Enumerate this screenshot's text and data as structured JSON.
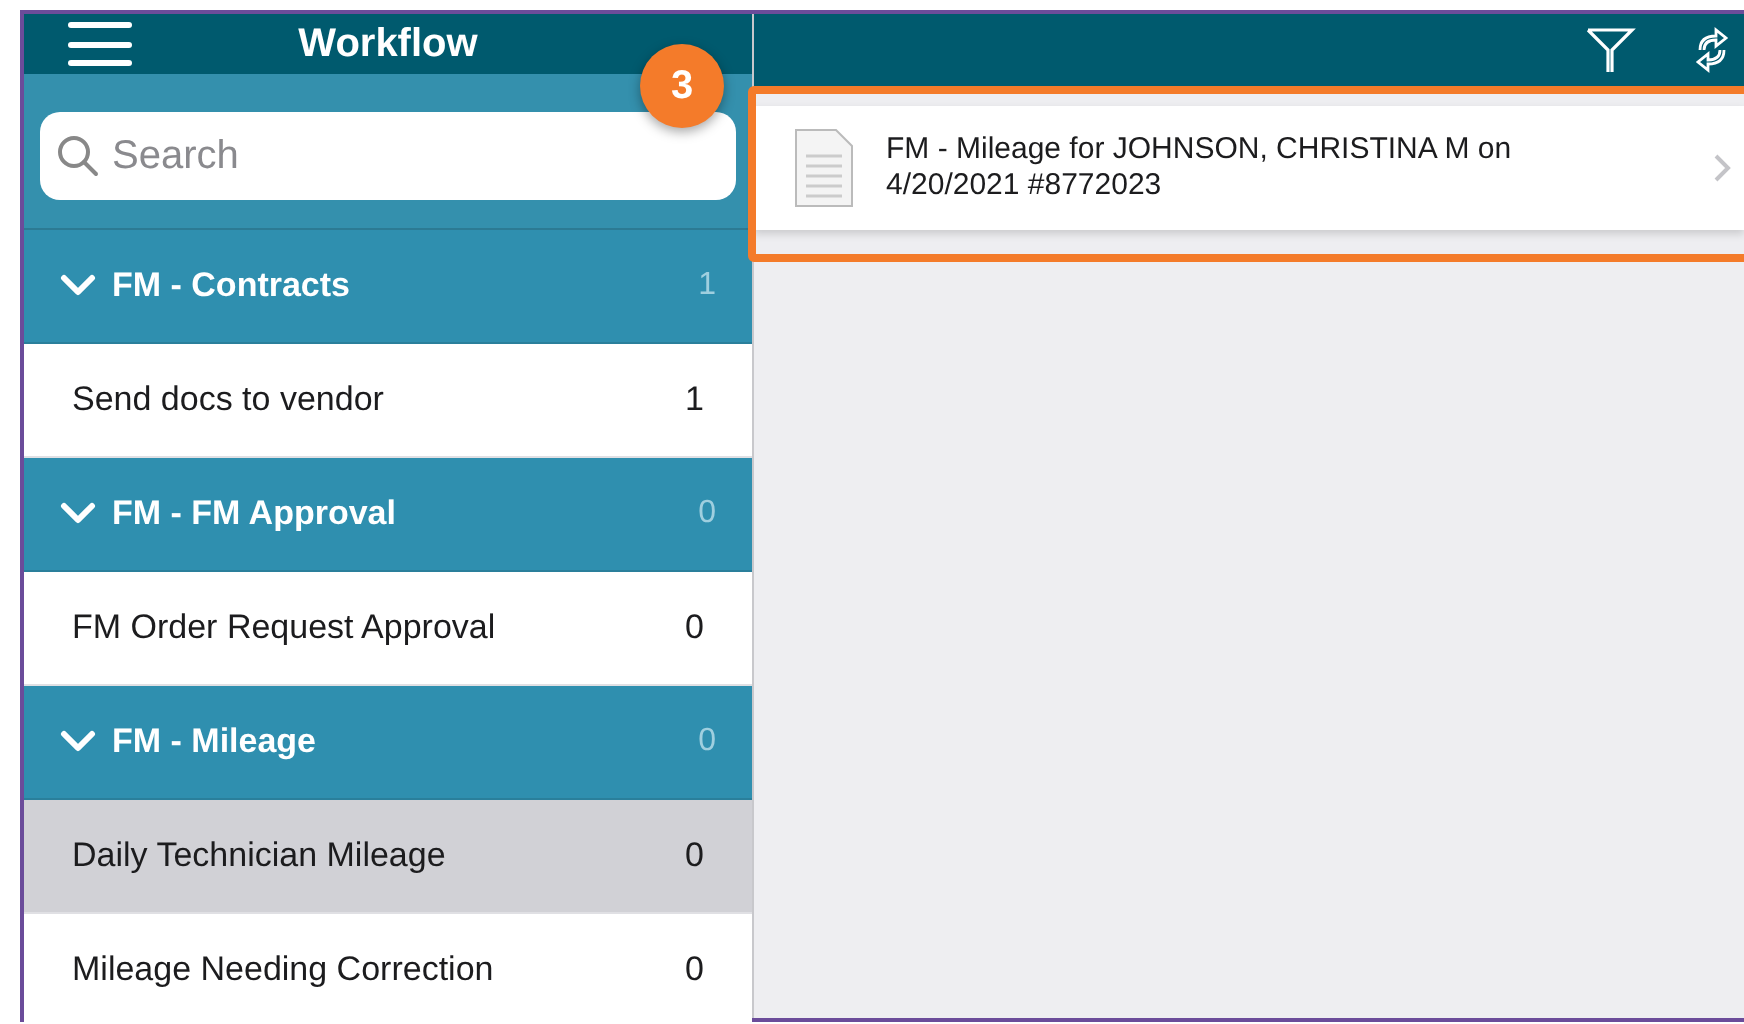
{
  "sidebar": {
    "title": "Workflow",
    "search": {
      "placeholder": "Search"
    },
    "groups": [
      {
        "label": "FM - Contracts",
        "count": "1",
        "expanded": true,
        "items": [
          {
            "label": "Send docs to vendor",
            "count": "1",
            "selected": false
          }
        ]
      },
      {
        "label": "FM - FM Approval",
        "count": "0",
        "expanded": true,
        "items": [
          {
            "label": "FM Order Request Approval",
            "count": "0",
            "selected": false
          }
        ]
      },
      {
        "label": "FM - Mileage",
        "count": "0",
        "expanded": true,
        "items": [
          {
            "label": "Daily Technician Mileage",
            "count": "0",
            "selected": true
          },
          {
            "label": "Mileage Needing Correction",
            "count": "0",
            "selected": false
          }
        ]
      }
    ]
  },
  "list": {
    "items": [
      {
        "title": "FM - Mileage for JOHNSON, CHRISTINA M on 4/20/2021 #8772023"
      }
    ]
  },
  "callout": {
    "number": "3"
  }
}
